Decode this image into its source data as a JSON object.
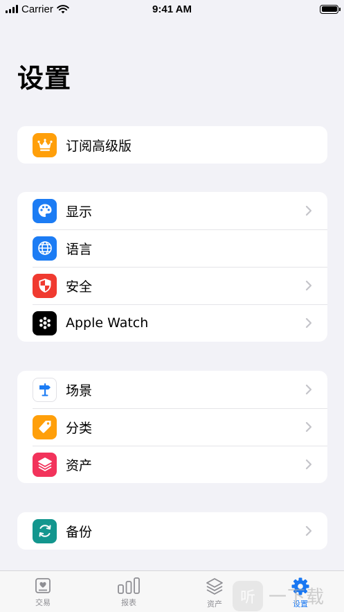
{
  "status_bar": {
    "carrier": "Carrier",
    "time": "9:41 AM"
  },
  "page": {
    "title": "设置"
  },
  "groups": [
    {
      "items": [
        {
          "label": "订阅高级版",
          "icon": "crown-icon",
          "color": "#ff9f0a",
          "chevron": false
        }
      ]
    },
    {
      "items": [
        {
          "label": "显示",
          "icon": "palette-icon",
          "color": "#1c7cf4",
          "chevron": true
        },
        {
          "label": "语言",
          "icon": "globe-icon",
          "color": "#1c7cf4",
          "chevron": false
        },
        {
          "label": "安全",
          "icon": "shield-icon",
          "color": "#f03a30",
          "chevron": true
        },
        {
          "label": "Apple Watch",
          "icon": "apple-watch-icon",
          "color": "#000000",
          "chevron": true
        }
      ]
    },
    {
      "items": [
        {
          "label": "场景",
          "icon": "signpost-icon",
          "color": "#ffffff",
          "chevron": true
        },
        {
          "label": "分类",
          "icon": "tag-icon",
          "color": "#ff9f0a",
          "chevron": true
        },
        {
          "label": "资产",
          "icon": "layers-icon",
          "color": "#f2335b",
          "chevron": true
        }
      ]
    },
    {
      "items": [
        {
          "label": "备份",
          "icon": "sync-icon",
          "color": "#13968e",
          "chevron": true
        }
      ]
    }
  ],
  "tab_bar": {
    "tabs": [
      {
        "label": "交易",
        "icon": "transactions-icon",
        "active": false
      },
      {
        "label": "报表",
        "icon": "chart-icon",
        "active": false
      },
      {
        "label": "资产",
        "icon": "assets-icon",
        "active": false
      },
      {
        "label": "设置",
        "icon": "gear-icon",
        "active": true
      }
    ],
    "active_color": "#1877f2"
  },
  "watermark": {
    "text": "一下载",
    "badge": "听"
  }
}
